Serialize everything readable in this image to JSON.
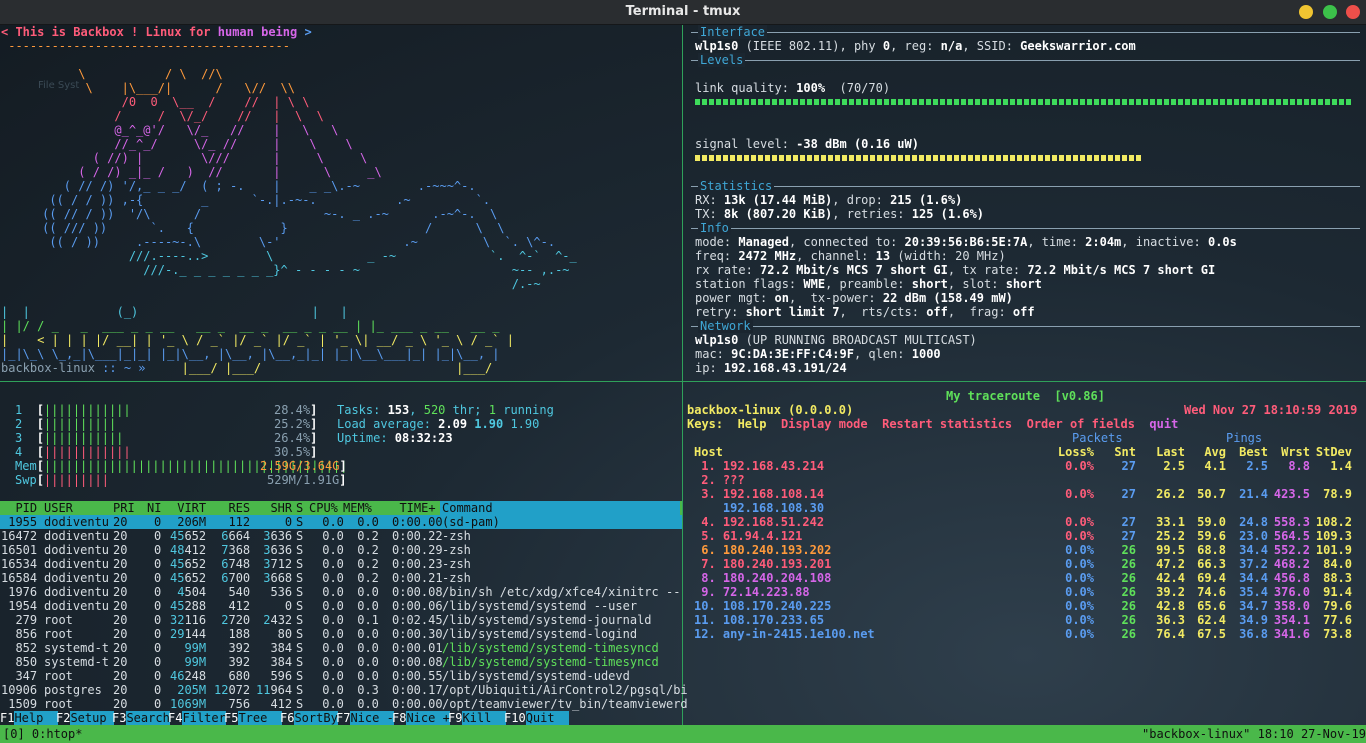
{
  "window": {
    "title": "Terminal - tmux"
  },
  "banner": {
    "line1_a": "< This is Backbox ! Linux for",
    "line1_b": "human being",
    "line1_c": ">",
    "dashes": " ---------------------------------------",
    "ghost_text": "File Syst",
    "prompt_host": "backbox-linux",
    "prompt_rest": " :: ~ »"
  },
  "wavemon": {
    "interface_hdr": "Interface",
    "interface_line": {
      "dev": "wlp1s0",
      "rest1": " (IEEE 802.11), phy ",
      "phy": "0",
      "rest2": ", reg: ",
      "reg": "n/a",
      "rest3": ", SSID: ",
      "ssid": "Geekswarrior.com"
    },
    "levels_hdr": "Levels",
    "link_quality_label": "link quality: ",
    "link_quality_value": "100%",
    "link_quality_frac": "  (70/70)",
    "signal_label": "signal level: ",
    "signal_value": "-38 dBm (0.16 uW)",
    "statistics_hdr": "Statistics",
    "rx": {
      "a": "RX: ",
      "v1": "13k (17.44 MiB)",
      "b": ", drop: ",
      "v2": "215 (1.6%)"
    },
    "tx": {
      "a": "TX: ",
      "v1": "8k (807.20 KiB)",
      "b": ", retries: ",
      "v2": "125 (1.6%)"
    },
    "info_hdr": "Info",
    "info": [
      {
        "a": "mode: ",
        "b": "Managed",
        "c": ", connected to: ",
        "d": "20:39:56:B6:5E:7A",
        "e": ", time: ",
        "f": "2:04m",
        "g": ", inactive: ",
        "h": "0.0s"
      },
      {
        "a": "freq: ",
        "b": "2472 MHz",
        "c": ", channel: ",
        "d": "13",
        "e": " (width: 20 MHz)",
        "f": "",
        "g": "",
        "h": ""
      },
      {
        "a": "rx rate: ",
        "b": "72.2 Mbit/s MCS 7 short GI",
        "c": ", tx rate: ",
        "d": "72.2 Mbit/s MCS 7 short GI",
        "e": "",
        "f": "",
        "g": "",
        "h": ""
      },
      {
        "a": "station flags: ",
        "b": "WME",
        "c": ", preamble: ",
        "d": "short",
        "e": ", slot: ",
        "f": "short",
        "g": "",
        "h": ""
      },
      {
        "a": "power mgt: ",
        "b": "on",
        "c": ",  tx-power: ",
        "d": "22 dBm (158.49 mW)",
        "e": "",
        "f": "",
        "g": "",
        "h": ""
      },
      {
        "a": "retry: ",
        "b": "short limit 7",
        "c": ",  rts/cts: ",
        "d": "off",
        "e": ",  frag: ",
        "f": "off",
        "g": "",
        "h": ""
      }
    ],
    "network_hdr": "Network",
    "net1": {
      "a": "wlp1s0",
      "b": " (UP RUNNING BROADCAST MULTICAST)"
    },
    "net2": {
      "a": "mac: ",
      "b": "9C:DA:3E:FF:C4:9F",
      "c": ", qlen: ",
      "d": "1000"
    },
    "net3": {
      "a": "ip: ",
      "b": "192.168.43.191/24"
    }
  },
  "htop": {
    "cpus": [
      {
        "id": "1",
        "bar": "||||||||||||",
        "pct": "28.4%"
      },
      {
        "id": "2",
        "bar": "||||||||||",
        "pct": "25.2%"
      },
      {
        "id": "3",
        "bar": "|||||||||||",
        "pct": "26.4%"
      },
      {
        "id": "4",
        "bar": "||||||||||||",
        "pct": "30.5%"
      }
    ],
    "mem_label": "Mem",
    "mem_bar": "||||||||||||||||||||||||||||||||||||||||||",
    "mem_value": "2.59G/3.64G",
    "swp_label": "Swp",
    "swp_bar": "|||||||||",
    "swp_value": "529M/1.91G",
    "tasks_label": "Tasks: ",
    "tasks": "153",
    "thr": "520",
    "thr_label": " thr; ",
    "running": "1",
    "running_label": " running",
    "load_label": "Load average: ",
    "load1": "2.09",
    "load5": "1.90",
    "load15": "1.90",
    "uptime_label": "Uptime: ",
    "uptime": "08:32:23",
    "headers": {
      "pid": "  PID",
      "user": "USER",
      "pri": "PRI",
      "ni": "NI",
      "virt": " VIRT",
      "res": "  RES",
      "shr": "  SHR",
      "s": "S",
      "cpu": "CPU%",
      "mem": "MEM%",
      "time": "  TIME+",
      "cmd": "Command"
    },
    "rows": [
      {
        "pid": " 1955",
        "user": "dodiventu",
        "pri": "20",
        "ni": "0",
        "virt": " 206M",
        "res": "  112",
        "shr": "    0",
        "s": "S",
        "cpu": " 0.0",
        "mem": " 0.0",
        "time": "0:00.00",
        "cmd": "(sd-pam)"
      },
      {
        "pid": "16472",
        "user": "dodiventu",
        "pri": "20",
        "ni": "0",
        "virt": "45652",
        "res": " 6664",
        "shr": " 3636",
        "s": "S",
        "cpu": " 0.0",
        "mem": " 0.2",
        "time": "0:00.22",
        "cmd": "-zsh"
      },
      {
        "pid": "16501",
        "user": "dodiventu",
        "pri": "20",
        "ni": "0",
        "virt": "48412",
        "res": " 7368",
        "shr": " 3636",
        "s": "S",
        "cpu": " 0.0",
        "mem": " 0.2",
        "time": "0:00.29",
        "cmd": "-zsh"
      },
      {
        "pid": "16534",
        "user": "dodiventu",
        "pri": "20",
        "ni": "0",
        "virt": "45652",
        "res": " 6748",
        "shr": " 3712",
        "s": "S",
        "cpu": " 0.0",
        "mem": " 0.2",
        "time": "0:00.23",
        "cmd": "-zsh"
      },
      {
        "pid": "16584",
        "user": "dodiventu",
        "pri": "20",
        "ni": "0",
        "virt": "45652",
        "res": " 6700",
        "shr": " 3668",
        "s": "S",
        "cpu": " 0.0",
        "mem": " 0.2",
        "time": "0:00.21",
        "cmd": "-zsh"
      },
      {
        "pid": " 1976",
        "user": "dodiventu",
        "pri": "20",
        "ni": "0",
        "virt": " 4504",
        "res": "  540",
        "shr": "  536",
        "s": "S",
        "cpu": " 0.0",
        "mem": " 0.0",
        "time": "0:00.08",
        "cmd": "/bin/sh /etc/xdg/xfce4/xinitrc --"
      },
      {
        "pid": " 1954",
        "user": "dodiventu",
        "pri": "20",
        "ni": "0",
        "virt": "45288",
        "res": "  412",
        "shr": "    0",
        "s": "S",
        "cpu": " 0.0",
        "mem": " 0.0",
        "time": "0:00.06",
        "cmd": "/lib/systemd/systemd --user"
      },
      {
        "pid": "  279",
        "user": "root",
        "pri": "20",
        "ni": "0",
        "virt": "32116",
        "res": " 2720",
        "shr": " 2432",
        "s": "S",
        "cpu": " 0.0",
        "mem": " 0.1",
        "time": "0:02.45",
        "cmd": "/lib/systemd/systemd-journald"
      },
      {
        "pid": "  856",
        "user": "root",
        "pri": "20",
        "ni": "0",
        "virt": "29144",
        "res": "  188",
        "shr": "   80",
        "s": "S",
        "cpu": " 0.0",
        "mem": " 0.0",
        "time": "0:00.30",
        "cmd": "/lib/systemd/systemd-logind"
      },
      {
        "pid": "  852",
        "user": "systemd-t",
        "pri": "20",
        "ni": "0",
        "virt": "  99M",
        "res": "  392",
        "shr": "  384",
        "s": "S",
        "cpu": " 0.0",
        "mem": " 0.0",
        "time": "0:00.01",
        "cmd": "/lib/systemd/systemd-timesyncd"
      },
      {
        "pid": "  850",
        "user": "systemd-t",
        "pri": "20",
        "ni": "0",
        "virt": "  99M",
        "res": "  392",
        "shr": "  384",
        "s": "S",
        "cpu": " 0.0",
        "mem": " 0.0",
        "time": "0:00.08",
        "cmd": "/lib/systemd/systemd-timesyncd"
      },
      {
        "pid": "  347",
        "user": "root",
        "pri": "20",
        "ni": "0",
        "virt": "46248",
        "res": "  680",
        "shr": "  596",
        "s": "S",
        "cpu": " 0.0",
        "mem": " 0.0",
        "time": "0:00.55",
        "cmd": "/lib/systemd/systemd-udevd"
      },
      {
        "pid": "10906",
        "user": "postgres",
        "pri": "20",
        "ni": "0",
        "virt": " 205M",
        "res": "12072",
        "shr": "11964",
        "s": "S",
        "cpu": " 0.0",
        "mem": " 0.3",
        "time": "0:00.17",
        "cmd": "/opt/Ubiquiti/AirControl2/pgsql/bi"
      },
      {
        "pid": " 1509",
        "user": "root",
        "pri": "20",
        "ni": "0",
        "virt": "1069M",
        "res": "  756",
        "shr": "  412",
        "s": "S",
        "cpu": " 0.0",
        "mem": " 0.0",
        "time": "0:00.00",
        "cmd": "/opt/teamviewer/tv_bin/teamviewerd"
      }
    ],
    "fkeys": [
      {
        "k": "F1",
        "l": "Help  "
      },
      {
        "k": "F2",
        "l": "Setup "
      },
      {
        "k": "F3",
        "l": "Search"
      },
      {
        "k": "F4",
        "l": "Filter"
      },
      {
        "k": "F5",
        "l": "Tree  "
      },
      {
        "k": "F6",
        "l": "SortBy"
      },
      {
        "k": "F7",
        "l": "Nice -"
      },
      {
        "k": "F8",
        "l": "Nice +"
      },
      {
        "k": "F9",
        "l": "Kill  "
      },
      {
        "k": "F10",
        "l": "Quit  "
      }
    ]
  },
  "mtr": {
    "title": "My traceroute  [v0.86]",
    "host": "backbox-linux (0.0.0.0)",
    "date": "Wed Nov 27 18:10:59 2019",
    "keys_label": "Keys:  ",
    "keys": [
      "Help",
      "Display mode",
      "Restart statistics",
      "Order of fields",
      "quit"
    ],
    "packets_hdr": "Packets",
    "pings_hdr": "Pings",
    "col_host": "Host",
    "cols": [
      "Loss%",
      "Snt",
      "Last",
      "Avg",
      "Best",
      "Wrst",
      "StDev"
    ],
    "hops": [
      {
        "n": " 1.",
        "h": "192.168.43.214",
        "loss": "0.0%",
        "snt": "27",
        "last": "2.5",
        "avg": "4.1",
        "best": "2.5",
        "wrst": "8.8",
        "stdev": "1.4"
      },
      {
        "n": " 2.",
        "h": "???",
        "loss": "",
        "snt": "",
        "last": "",
        "avg": "",
        "best": "",
        "wrst": "",
        "stdev": ""
      },
      {
        "n": " 3.",
        "h": "192.168.108.14",
        "loss": "0.0%",
        "snt": "27",
        "last": "26.2",
        "avg": "50.7",
        "best": "21.4",
        "wrst": "423.5",
        "stdev": "78.9"
      },
      {
        "n": "   ",
        "h": "192.168.108.30",
        "loss": "",
        "snt": "",
        "last": "",
        "avg": "",
        "best": "",
        "wrst": "",
        "stdev": ""
      },
      {
        "n": " 4.",
        "h": "192.168.51.242",
        "loss": "0.0%",
        "snt": "27",
        "last": "33.1",
        "avg": "59.0",
        "best": "24.8",
        "wrst": "558.3",
        "stdev": "108.2"
      },
      {
        "n": " 5.",
        "h": "61.94.4.121",
        "loss": "0.0%",
        "snt": "27",
        "last": "25.2",
        "avg": "59.6",
        "best": "23.0",
        "wrst": "564.5",
        "stdev": "109.3"
      },
      {
        "n": " 6.",
        "h": "180.240.193.202",
        "loss": "0.0%",
        "snt": "26",
        "last": "99.5",
        "avg": "68.8",
        "best": "34.4",
        "wrst": "552.2",
        "stdev": "101.9"
      },
      {
        "n": " 7.",
        "h": "180.240.193.201",
        "loss": "0.0%",
        "snt": "26",
        "last": "47.2",
        "avg": "66.3",
        "best": "37.2",
        "wrst": "468.2",
        "stdev": "84.0"
      },
      {
        "n": " 8.",
        "h": "180.240.204.108",
        "loss": "0.0%",
        "snt": "26",
        "last": "42.4",
        "avg": "69.4",
        "best": "34.4",
        "wrst": "456.8",
        "stdev": "88.3"
      },
      {
        "n": " 9.",
        "h": "72.14.223.88",
        "loss": "0.0%",
        "snt": "26",
        "last": "39.2",
        "avg": "74.6",
        "best": "35.4",
        "wrst": "376.0",
        "stdev": "91.4"
      },
      {
        "n": "10.",
        "h": "108.170.240.225",
        "loss": "0.0%",
        "snt": "26",
        "last": "42.8",
        "avg": "65.6",
        "best": "34.7",
        "wrst": "358.0",
        "stdev": "79.6"
      },
      {
        "n": "11.",
        "h": "108.170.233.65",
        "loss": "0.0%",
        "snt": "26",
        "last": "36.3",
        "avg": "62.4",
        "best": "34.9",
        "wrst": "354.1",
        "stdev": "77.6"
      },
      {
        "n": "12.",
        "h": "any-in-2415.1e100.net",
        "loss": "0.0%",
        "snt": "26",
        "last": "76.4",
        "avg": "67.5",
        "best": "36.8",
        "wrst": "341.6",
        "stdev": "73.8"
      }
    ]
  },
  "tmux": {
    "left": "[0] 0:htop*",
    "right": "\"backbox-linux\" 18:10 27-Nov-19"
  },
  "colors": {
    "accent_green": "#4ab84a",
    "select_cyan": "#21a0c8"
  }
}
